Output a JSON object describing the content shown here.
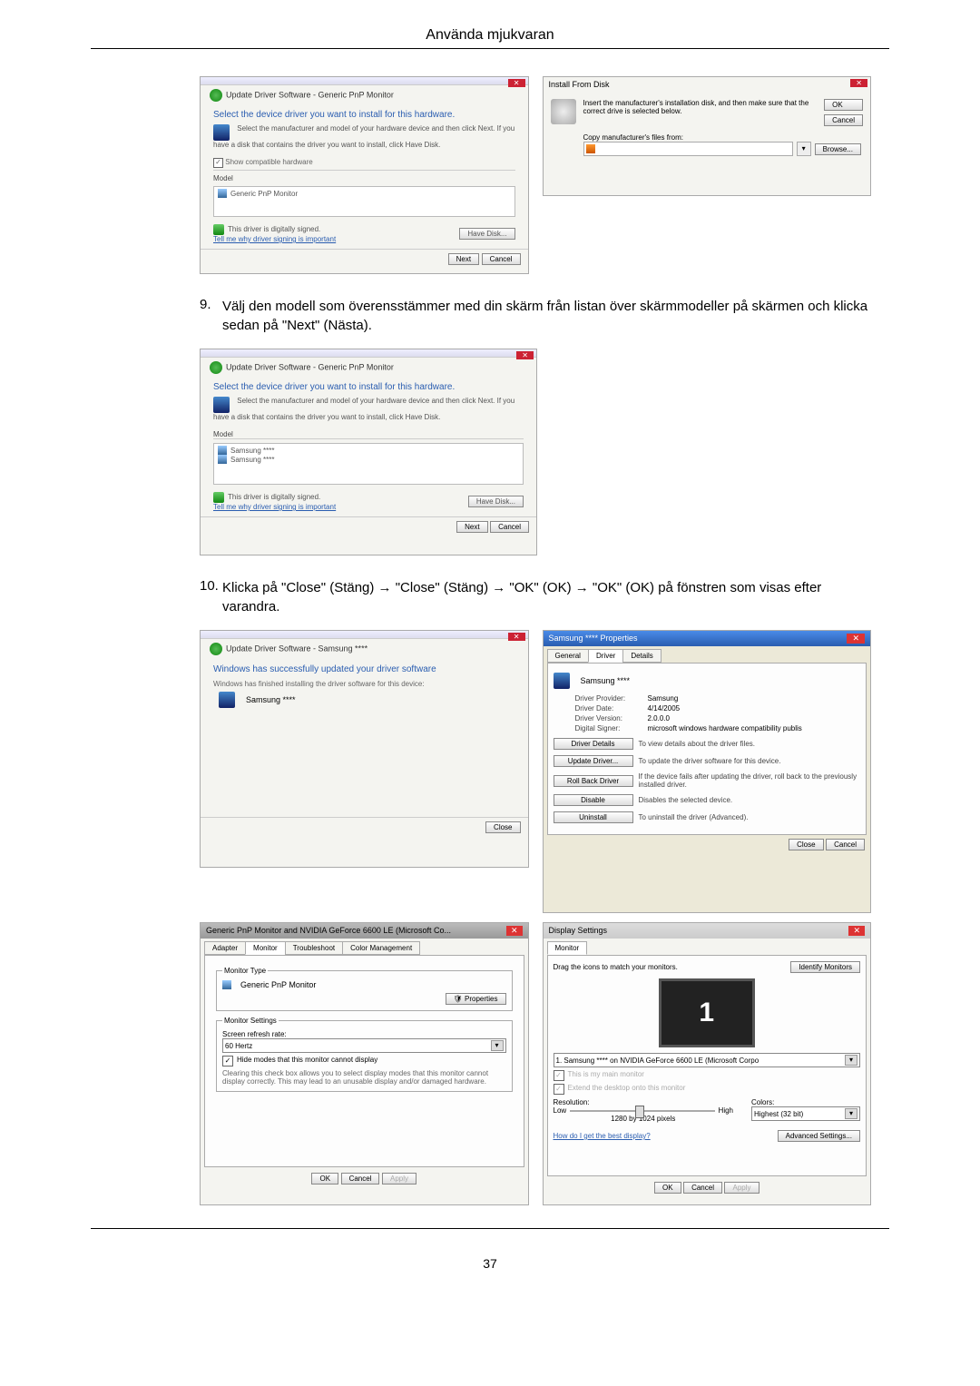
{
  "page": {
    "header": "Använda mjukvaran",
    "footer_page": "37"
  },
  "step9": {
    "num": "9.",
    "text": "Välj den modell som överensstämmer med din skärm från listan över skärmmodeller på skärmen och klicka sedan på \"Next\" (Nästa)."
  },
  "step10": {
    "num": "10.",
    "text": "Klicka på \"Close\" (Stäng) → \"Close\" (Stäng) → \"OK\" (OK) → \"OK\" (OK) på fönstren som visas efter varandra."
  },
  "wizard1": {
    "breadcrumb": "Update Driver Software - Generic PnP Monitor",
    "title": "Select the device driver you want to install for this hardware.",
    "hint": "Select the manufacturer and model of your hardware device and then click Next. If you have a disk that contains the driver you want to install, click Have Disk.",
    "compat": "Show compatible hardware",
    "model": "Model",
    "item": "Generic PnP Monitor",
    "signed": "This driver is digitally signed.",
    "tell": "Tell me why driver signing is important",
    "havedisk": "Have Disk...",
    "next": "Next",
    "cancel": "Cancel"
  },
  "installdisk": {
    "title": "Install From Disk",
    "text": "Insert the manufacturer's installation disk, and then make sure that the correct drive is selected below.",
    "copy": "Copy manufacturer's files from:",
    "ok": "OK",
    "cancel": "Cancel",
    "browse": "Browse..."
  },
  "wizard2": {
    "breadcrumb": "Update Driver Software - Generic PnP Monitor",
    "title": "Select the device driver you want to install for this hardware.",
    "hint": "Select the manufacturer and model of your hardware device and then click Next. If you have a disk that contains the driver you want to install, click Have Disk.",
    "model": "Model",
    "item1": "Samsung ****",
    "item2": "Samsung ****",
    "signed": "This driver is digitally signed.",
    "tell": "Tell me why driver signing is important",
    "havedisk": "Have Disk...",
    "next": "Next",
    "cancel": "Cancel"
  },
  "closewiz": {
    "breadcrumb": "Update Driver Software - Samsung ****",
    "title": "Windows has successfully updated your driver software",
    "hint": "Windows has finished installing the driver software for this device:",
    "device": "Samsung ****",
    "close": "Close"
  },
  "props": {
    "title": "Samsung **** Properties",
    "tab_general": "General",
    "tab_driver": "Driver",
    "tab_details": "Details",
    "device": "Samsung ****",
    "provider_l": "Driver Provider:",
    "provider_v": "Samsung",
    "date_l": "Driver Date:",
    "date_v": "4/14/2005",
    "version_l": "Driver Version:",
    "version_v": "2.0.0.0",
    "signer_l": "Digital Signer:",
    "signer_v": "microsoft windows hardware compatibility publis",
    "b_details": "Driver Details",
    "d_details": "To view details about the driver files.",
    "b_update": "Update Driver...",
    "d_update": "To update the driver software for this device.",
    "b_rollback": "Roll Back Driver",
    "d_rollback": "If the device fails after updating the driver, roll back to the previously installed driver.",
    "b_disable": "Disable",
    "d_disable": "Disables the selected device.",
    "b_uninstall": "Uninstall",
    "d_uninstall": "To uninstall the driver (Advanced).",
    "close": "Close",
    "cancel": "Cancel"
  },
  "adapter": {
    "title": "Generic PnP Monitor and NVIDIA GeForce 6600 LE (Microsoft Co...",
    "tab_adapter": "Adapter",
    "tab_monitor": "Monitor",
    "tab_ts": "Troubleshoot",
    "tab_cm": "Color Management",
    "montype": "Monitor Type",
    "monname": "Generic PnP Monitor",
    "properties": "Properties",
    "settings": "Monitor Settings",
    "refresh": "Screen refresh rate:",
    "refresh_v": "60 Hertz",
    "hide": "Hide modes that this monitor cannot display",
    "hidetext": "Clearing this check box allows you to select display modes that this monitor cannot display correctly. This may lead to an unusable display and/or damaged hardware.",
    "ok": "OK",
    "cancel": "Cancel",
    "apply": "Apply"
  },
  "display": {
    "title": "Display Settings",
    "tab": "Monitor",
    "drag": "Drag the icons to match your monitors.",
    "identify": "Identify Monitors",
    "num": "1",
    "combo": "1. Samsung **** on NVIDIA GeForce 6600 LE (Microsoft Corpo",
    "main": "This is my main monitor",
    "extend": "Extend the desktop onto this monitor",
    "res_l": "Resolution:",
    "low": "Low",
    "high": "High",
    "res_v": "1280 by 1024 pixels",
    "colors_l": "Colors:",
    "colors_v": "Highest (32 bit)",
    "help": "How do I get the best display?",
    "advanced": "Advanced Settings...",
    "ok": "OK",
    "cancel": "Cancel",
    "apply": "Apply"
  }
}
